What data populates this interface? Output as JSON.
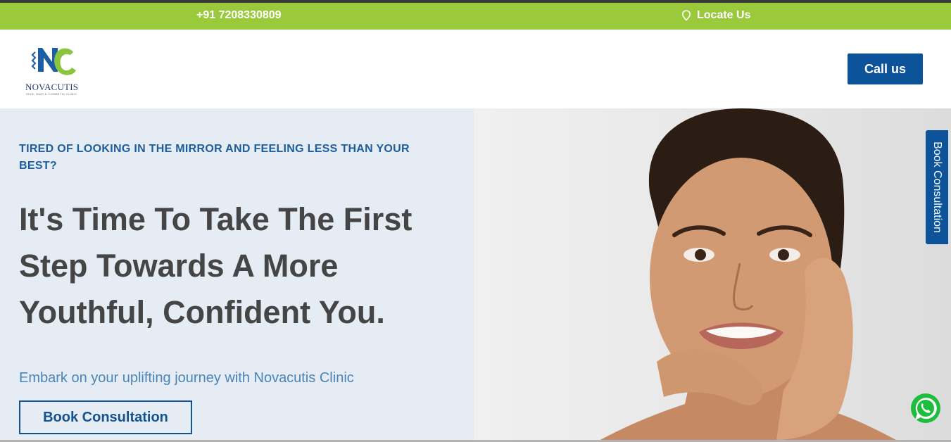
{
  "topbar": {
    "phone": "+91 7208330809",
    "locate_label": "Locate Us",
    "locate_icon": "location-pin-icon",
    "background": "#9bc93c"
  },
  "header": {
    "logo": {
      "brand": "NOVACUTIS",
      "tagline": "SKIN, HAIR & COSMETIC CLINIC"
    },
    "call_button": "Call us"
  },
  "hero": {
    "kicker": "TIRED OF LOOKING IN THE MIRROR AND FEELING LESS THAN YOUR BEST?",
    "headline": "It's Time To Take The First Step Towards A More Youthful, Confident You.",
    "subline": "Embark on your uplifting journey with Novacutis Clinic",
    "cta": "Book Consultation",
    "image_alt": "woman-portrait"
  },
  "side_tab": {
    "label": "Book Consultation"
  },
  "floating": {
    "whatsapp_icon": "whatsapp-icon"
  },
  "colors": {
    "primary_blue": "#0c539a",
    "accent_green": "#9bc93c",
    "hero_bg": "#e5ecf4",
    "headline_text": "#454545"
  }
}
